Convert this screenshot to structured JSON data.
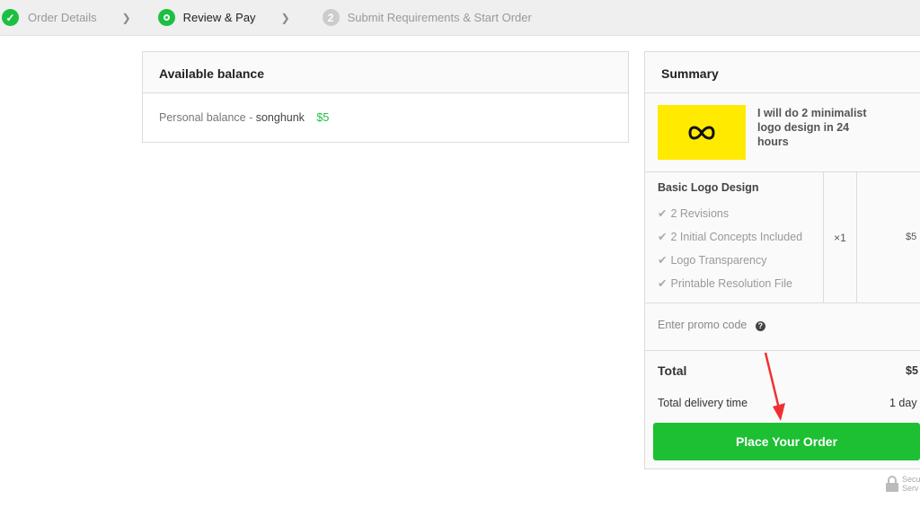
{
  "steps": [
    {
      "label": "Order Details",
      "icon": "check-icon",
      "state": "done"
    },
    {
      "label": "Review & Pay",
      "icon": "location-pin-icon",
      "state": "active"
    },
    {
      "label": "Submit Requirements & Start Order",
      "number": "2",
      "state": "pending"
    }
  ],
  "balance": {
    "title": "Available balance",
    "label": "Personal balance",
    "separator": " - ",
    "user": "songhunk",
    "amount": "$5"
  },
  "summary": {
    "title": "Summary",
    "gig_title": "I will do 2 minimalist logo design in 24 hours",
    "package": "Basic Logo Design",
    "features": [
      "2 Revisions",
      "2 Initial Concepts Included",
      "Logo Transparency",
      "Printable Resolution File"
    ],
    "quantity": "×1",
    "price": "$5",
    "promo": "Enter promo code",
    "total_label": "Total",
    "total": "$5",
    "delivery_label": "Total delivery time",
    "delivery": "1 day",
    "button": "Place Your Order"
  },
  "secure": {
    "line1": "Secu",
    "line2": "Serv"
  },
  "colors": {
    "accent": "#1dbf43",
    "annotation_arrow": "#f03030",
    "thumbnail": "#ffea00"
  }
}
